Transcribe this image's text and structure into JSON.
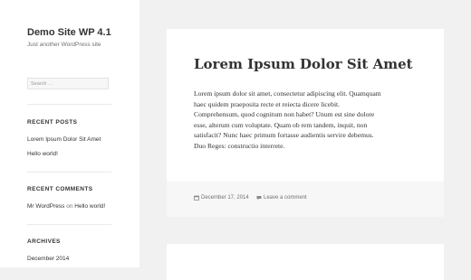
{
  "site": {
    "title": "Demo Site WP 4.1",
    "description": "Just another WordPress site"
  },
  "search": {
    "placeholder": "Search …"
  },
  "widgets": {
    "recent_posts": {
      "title": "RECENT POSTS",
      "items": [
        "Lorem Ipsum Dolor Sit Amet",
        "Hello world!"
      ]
    },
    "recent_comments": {
      "title": "RECENT COMMENTS",
      "author": "Mr WordPress",
      "on": "on",
      "post": "Hello world!"
    },
    "archives": {
      "title": "ARCHIVES",
      "items": [
        "December 2014"
      ]
    }
  },
  "post": {
    "title": "Lorem Ipsum Dolor Sit Amet",
    "body_lines": [
      "Lorem ipsum dolor sit amet, consectetur adipiscing elit. Quamquam",
      "haec quidem praeposita recte et reiecta dicere licebit.",
      "Comprehensum, quod cognitum non habet? Unum est sine dolore",
      "esse, alterum cum voluptate. Quam ob rem tandem, inquit, non",
      "satisfacit? Nunc haec primum fortasse audientis servire debemus.",
      "Duo Reges: constructio interrete."
    ],
    "date": "December 17, 2014",
    "comment_link": "Leave a comment"
  },
  "icons": {
    "date": "calendar-icon",
    "comment": "comment-bubble-icon"
  }
}
